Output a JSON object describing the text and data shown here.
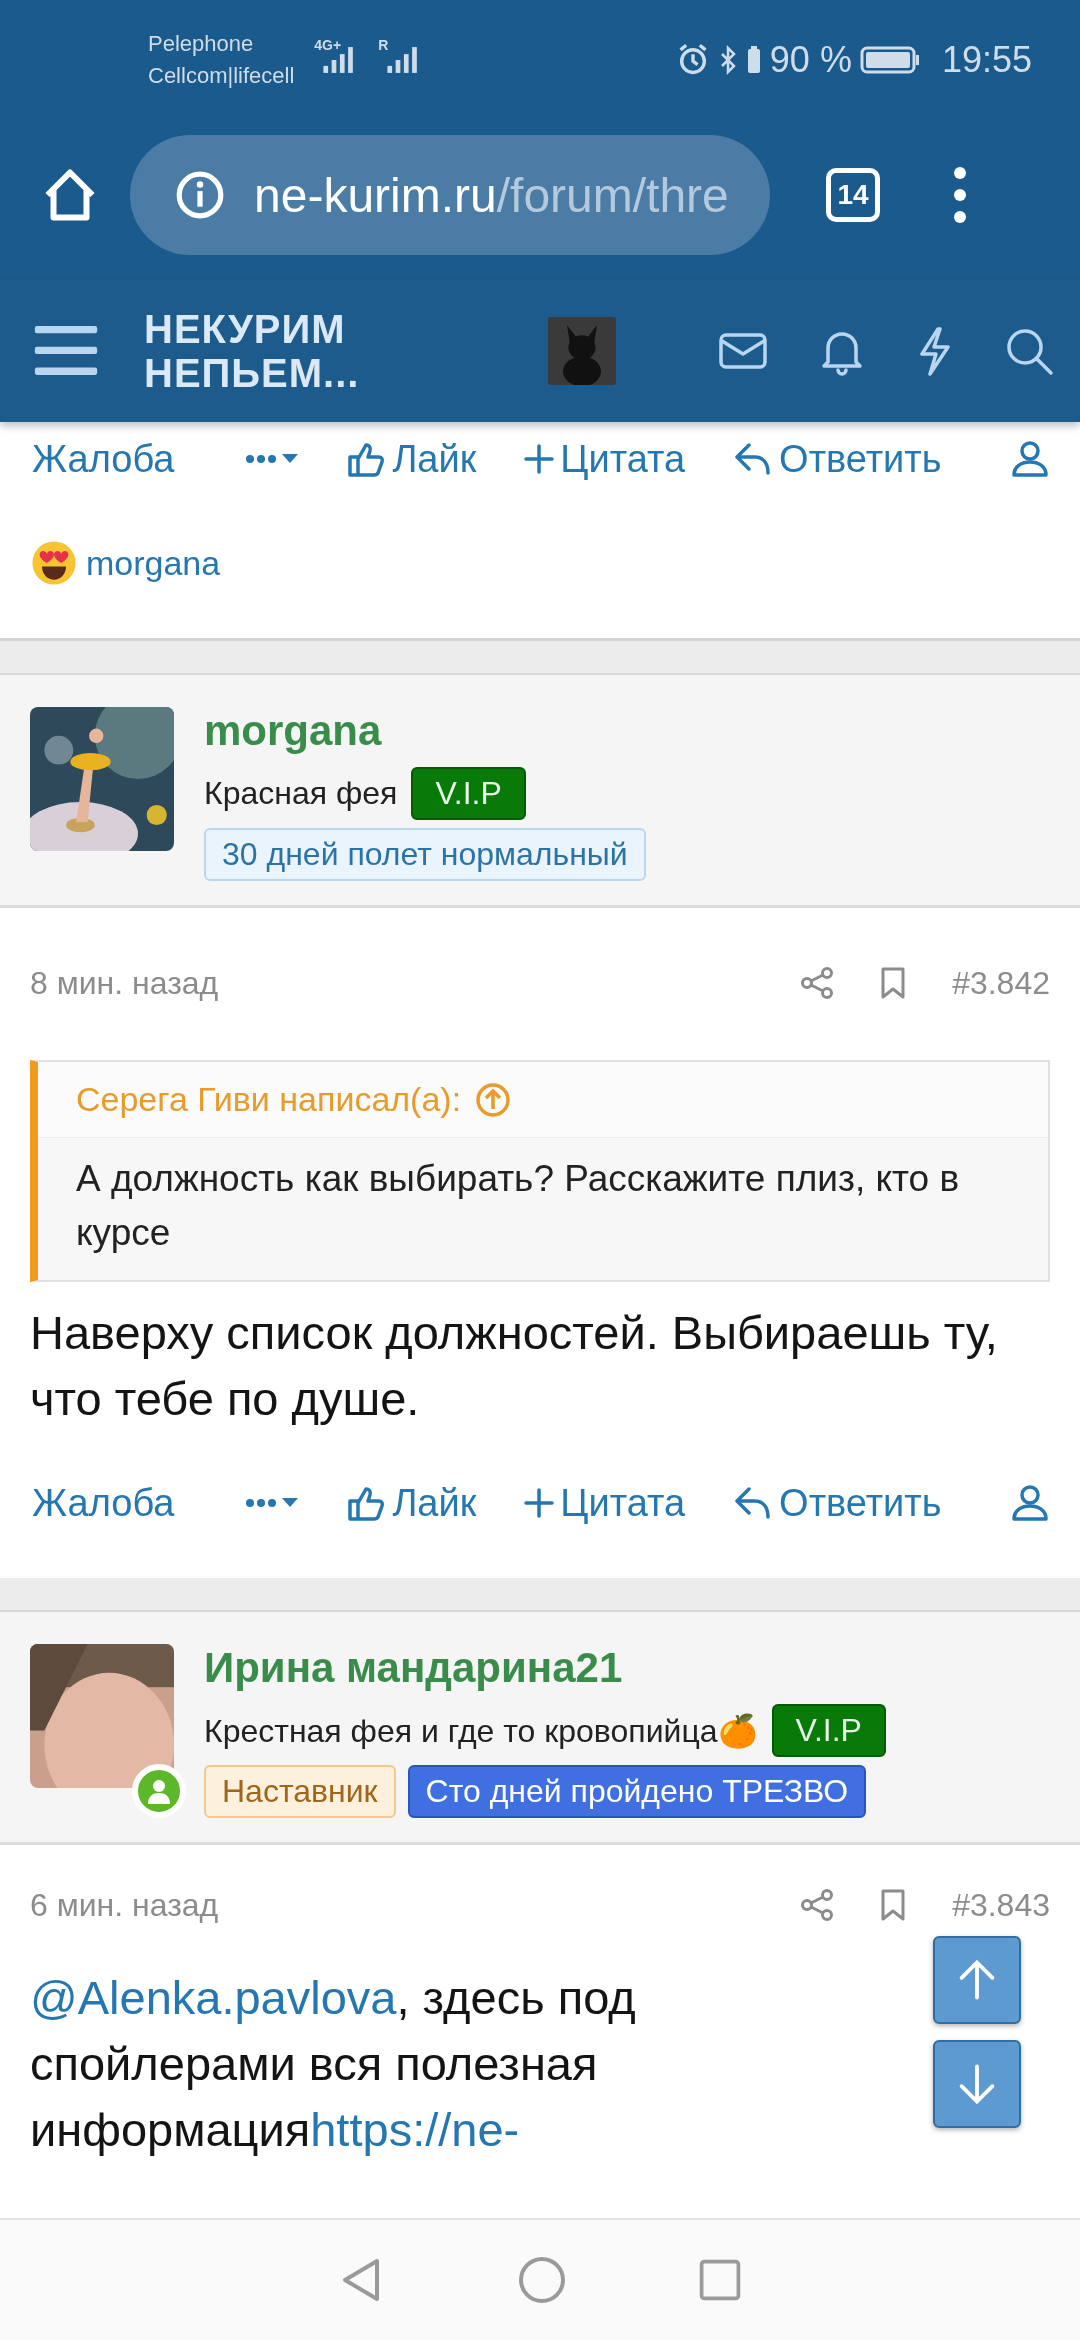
{
  "status_bar": {
    "carrier_1": "Pelephone",
    "carrier_2": "Cellcom|lifecell",
    "network": "4G+",
    "roaming": "R",
    "battery": "90 %",
    "time": "19:55"
  },
  "browser": {
    "url_host": "ne-kurim.ru",
    "url_path": "/forum/thre",
    "tab_count": "14"
  },
  "site_header": {
    "logo_line_1": "НЕКУРИМ",
    "logo_line_2": "НЕПЬЕМ..."
  },
  "top_actions": {
    "report": "Жалоба",
    "like": "Лайк",
    "quote": "Цитата",
    "reply": "Ответить"
  },
  "reaction": {
    "user": "morgana"
  },
  "posts": [
    {
      "author": "morgana",
      "title": "Красная фея",
      "online": false,
      "title_badge": "V.I.P",
      "banners": [
        {
          "label": "30 дней полет нормальный",
          "kind": "light"
        }
      ],
      "time": "8 мин. назад",
      "number": "#3.842",
      "quote": {
        "author": "Серега Гиви написал(а):",
        "text": "А должность как выбирать? Расскажите плиз, кто в курсе"
      },
      "body": [
        {
          "kind": "text",
          "text": "Наверху список должностей. Выбираешь ту, что тебе по душе."
        }
      ],
      "actions": {
        "report": "Жалоба",
        "like": "Лайк",
        "quote": "Цитата",
        "reply": "Ответить"
      }
    },
    {
      "author": "Ирина мандарина21",
      "title": "Крестная фея и где то кровопийца🍊",
      "online": true,
      "title_badge": "V.I.P",
      "banners": [
        {
          "label": "Наставник",
          "kind": "mentor"
        },
        {
          "label": "Сто дней пройдено ТРЕЗВО",
          "kind": "blue"
        }
      ],
      "time": "6 мин. назад",
      "number": "#3.843",
      "body": [
        {
          "kind": "link",
          "text": "@Alenka.pavlova"
        },
        {
          "kind": "text",
          "text": ", здесь под спойлерами вся полезная информация"
        },
        {
          "kind": "link",
          "text": "https://ne-"
        }
      ]
    }
  ]
}
